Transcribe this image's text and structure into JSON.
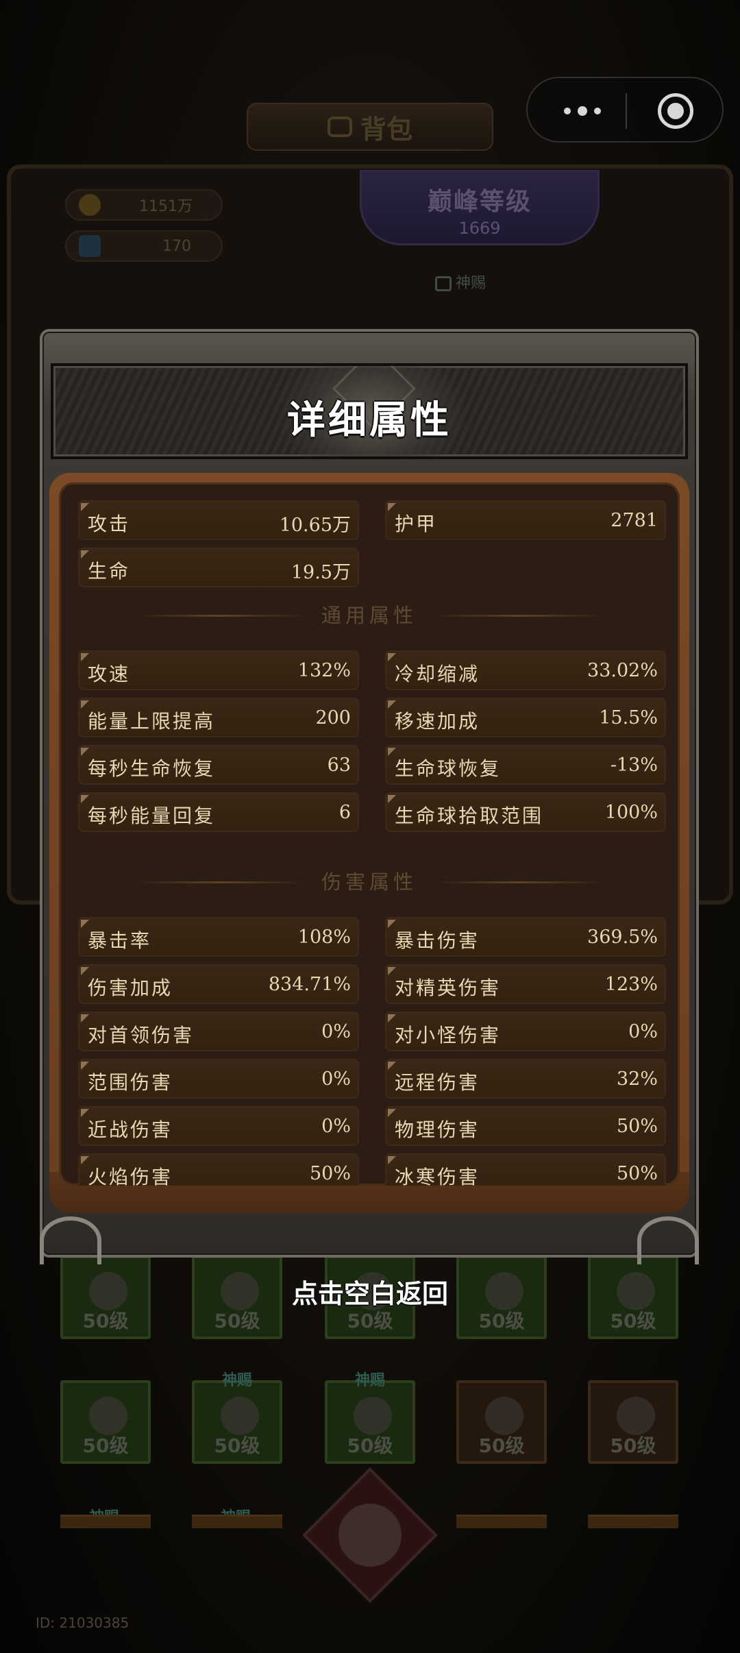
{
  "background": {
    "title": "背包",
    "resources": {
      "coins": "1151万",
      "gems": "170"
    },
    "peak_level": {
      "title": "巅峰等级",
      "value": "1669"
    },
    "god_tag": "神赐",
    "level_text": "50级",
    "user_id": "ID: 21030385"
  },
  "capsule": {
    "more_icon": "more-dots-icon",
    "close_icon": "target-circle-icon"
  },
  "modal": {
    "title": "详细属性",
    "basic_stats": [
      {
        "label": "攻击",
        "value": "10.65万"
      },
      {
        "label": "护甲",
        "value": "2781"
      },
      {
        "label": "生命",
        "value": "19.5万"
      }
    ],
    "general_section_title": "通用属性",
    "general_stats": [
      {
        "label": "攻速",
        "value": "132%"
      },
      {
        "label": "冷却缩减",
        "value": "33.02%"
      },
      {
        "label": "能量上限提高",
        "value": "200"
      },
      {
        "label": "移速加成",
        "value": "15.5%"
      },
      {
        "label": "每秒生命恢复",
        "value": "63"
      },
      {
        "label": "生命球恢复",
        "value": "-13%"
      },
      {
        "label": "每秒能量回复",
        "value": "6"
      },
      {
        "label": "生命球拾取范围",
        "value": "100%"
      }
    ],
    "damage_section_title": "伤害属性",
    "damage_stats": [
      {
        "label": "暴击率",
        "value": "108%"
      },
      {
        "label": "暴击伤害",
        "value": "369.5%"
      },
      {
        "label": "伤害加成",
        "value": "834.71%"
      },
      {
        "label": "对精英伤害",
        "value": "123%"
      },
      {
        "label": "对首领伤害",
        "value": "0%"
      },
      {
        "label": "对小怪伤害",
        "value": "0%"
      },
      {
        "label": "范围伤害",
        "value": "0%"
      },
      {
        "label": "远程伤害",
        "value": "32%"
      },
      {
        "label": "近战伤害",
        "value": "0%"
      },
      {
        "label": "物理伤害",
        "value": "50%"
      },
      {
        "label": "火焰伤害",
        "value": "50%"
      },
      {
        "label": "冰寒伤害",
        "value": "50%"
      }
    ]
  },
  "hint": "点击空白返回"
}
